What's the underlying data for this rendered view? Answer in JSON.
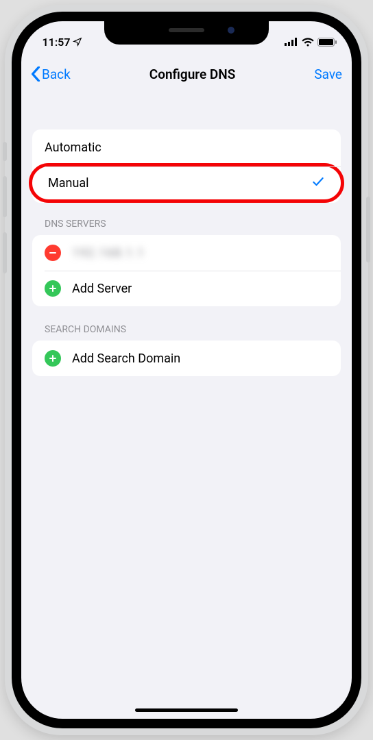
{
  "status": {
    "time": "11:57"
  },
  "nav": {
    "back": "Back",
    "title": "Configure DNS",
    "save": "Save"
  },
  "config": {
    "automatic": "Automatic",
    "manual": "Manual"
  },
  "dns_servers": {
    "header": "DNS SERVERS",
    "server0": "192.168.1.1",
    "add": "Add Server"
  },
  "search_domains": {
    "header": "SEARCH DOMAINS",
    "add": "Add Search Domain"
  }
}
